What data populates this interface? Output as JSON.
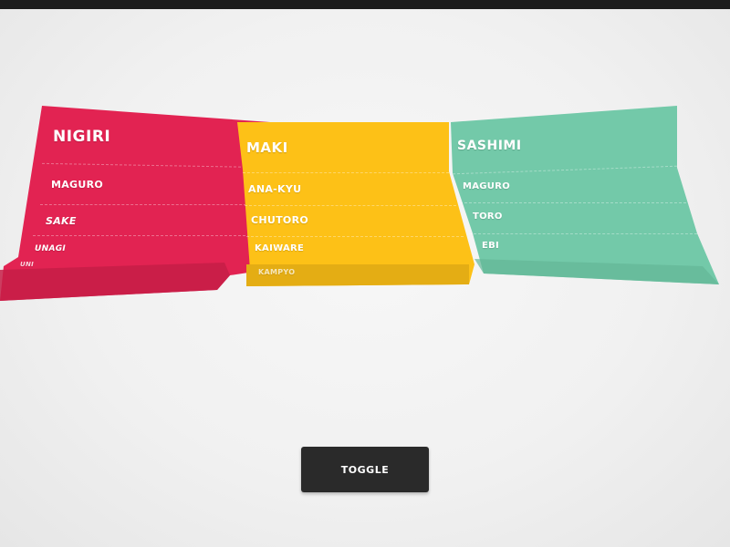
{
  "colors": {
    "nigiri": "#e22352",
    "maki": "#fdc117",
    "sashimi": "#73c9a9",
    "button": "#2a2a2a",
    "topbar": "#1c1c1c"
  },
  "panels": {
    "nigiri": {
      "title": "NIGIRI",
      "items": [
        "MAGURO",
        "SAKE",
        "UNAGI",
        "UNI"
      ]
    },
    "maki": {
      "title": "MAKI",
      "items": [
        "ANA-KYU",
        "CHUTORO",
        "KAIWARE",
        "KAMPYO"
      ]
    },
    "sashimi": {
      "title": "SASHIMI",
      "items": [
        "MAGURO",
        "TORO",
        "EBI"
      ]
    }
  },
  "toggle": {
    "label": "TOGGLE"
  }
}
